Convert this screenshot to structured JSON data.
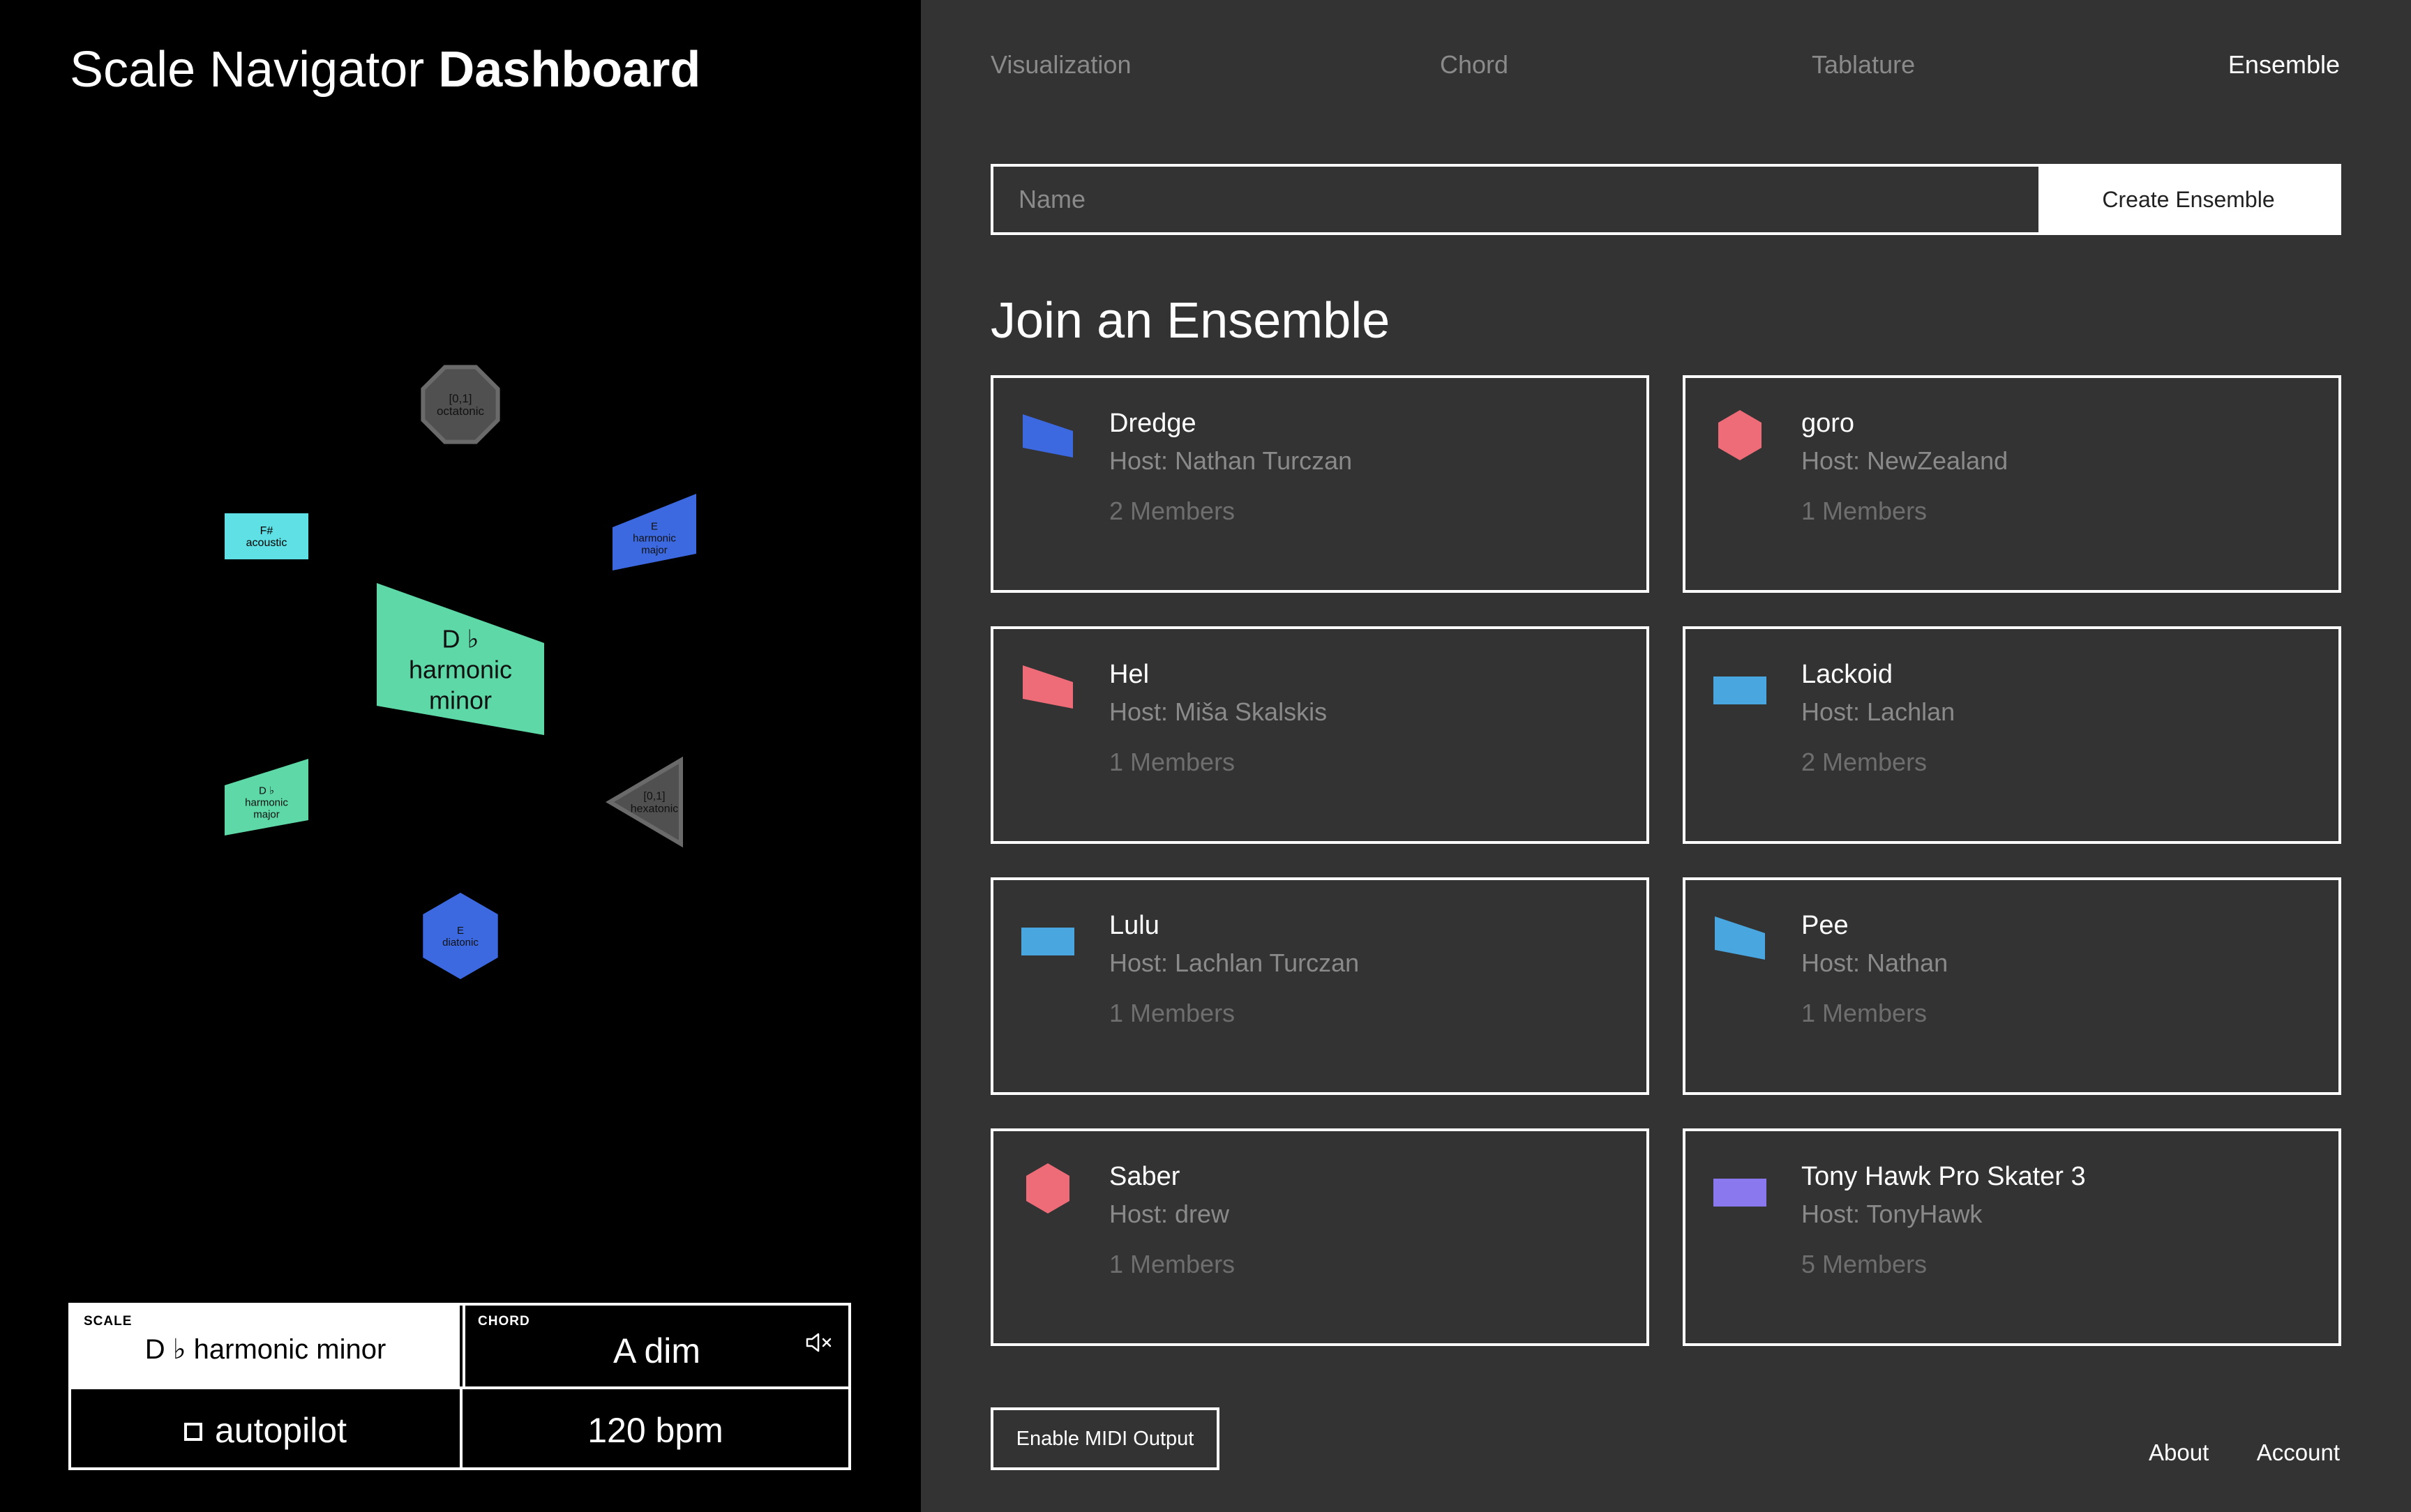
{
  "app": {
    "title_light": "Scale Navigator ",
    "title_bold": "Dashboard"
  },
  "graph_nodes": [
    {
      "id": "center",
      "lines": [
        "D ♭",
        "harmonic",
        "minor"
      ],
      "shape": "trapezoid",
      "color": "#5dd8a6"
    },
    {
      "id": "top",
      "lines": [
        "[0,1]",
        "octatonic"
      ],
      "shape": "octagon",
      "color": "#505050"
    },
    {
      "id": "upper-left",
      "lines": [
        "F#",
        "acoustic"
      ],
      "shape": "rectangle",
      "color": "#5ee0e4"
    },
    {
      "id": "upper-right",
      "lines": [
        "E",
        "harmonic",
        "major"
      ],
      "shape": "trapezoid",
      "color": "#3c69e0"
    },
    {
      "id": "lower-left",
      "lines": [
        "D ♭",
        "harmonic",
        "major"
      ],
      "shape": "trapezoid",
      "color": "#5dd8a6"
    },
    {
      "id": "lower-right",
      "lines": [
        "[0,1]",
        "hexatonic"
      ],
      "shape": "triangle",
      "color": "#505050"
    },
    {
      "id": "bottom",
      "lines": [
        "E",
        "diatonic"
      ],
      "shape": "hexagon",
      "color": "#3c69e0"
    }
  ],
  "status": {
    "scale_tag": "SCALE",
    "scale_value": "D ♭  harmonic minor",
    "chord_tag": "CHORD",
    "chord_value": "A dim",
    "autopilot_label": "autopilot",
    "bpm_value": "120 bpm"
  },
  "tabs": [
    "Visualization",
    "Chord",
    "Tablature",
    "Ensemble"
  ],
  "active_tab": "Ensemble",
  "create": {
    "placeholder": "Name",
    "button_label": "Create Ensemble"
  },
  "join_heading": "Join an Ensemble",
  "ensembles": [
    {
      "name": "Dredge",
      "host": "Host: Nathan Turczan",
      "members": "2 Members",
      "icon": "slanted-quad-icon",
      "color": "#3c69e0"
    },
    {
      "name": "goro",
      "host": "Host: NewZealand",
      "members": "1 Members",
      "icon": "hexagon-icon",
      "color": "#ee6c78"
    },
    {
      "name": "Hel",
      "host": "Host: Miša Skalskis",
      "members": "1 Members",
      "icon": "slanted-quad-icon",
      "color": "#ee6c78"
    },
    {
      "name": "Lackoid",
      "host": "Host: Lachlan",
      "members": "2 Members",
      "icon": "rectangle-icon",
      "color": "#4aa6de"
    },
    {
      "name": "Lulu",
      "host": "Host: Lachlan Turczan",
      "members": "1 Members",
      "icon": "rectangle-icon",
      "color": "#4aa6de"
    },
    {
      "name": "Pee",
      "host": "Host: Nathan",
      "members": "1 Members",
      "icon": "slanted-quad-icon",
      "color": "#4aa6de"
    },
    {
      "name": "Saber",
      "host": "Host: drew",
      "members": "1 Members",
      "icon": "hexagon-icon",
      "color": "#ee6c78"
    },
    {
      "name": "Tony Hawk Pro Skater 3",
      "host": "Host: TonyHawk",
      "members": "5 Members",
      "icon": "rectangle-icon",
      "color": "#8a78ee"
    }
  ],
  "midi_button": "Enable MIDI Output",
  "footer": {
    "about": "About",
    "account": "Account"
  }
}
